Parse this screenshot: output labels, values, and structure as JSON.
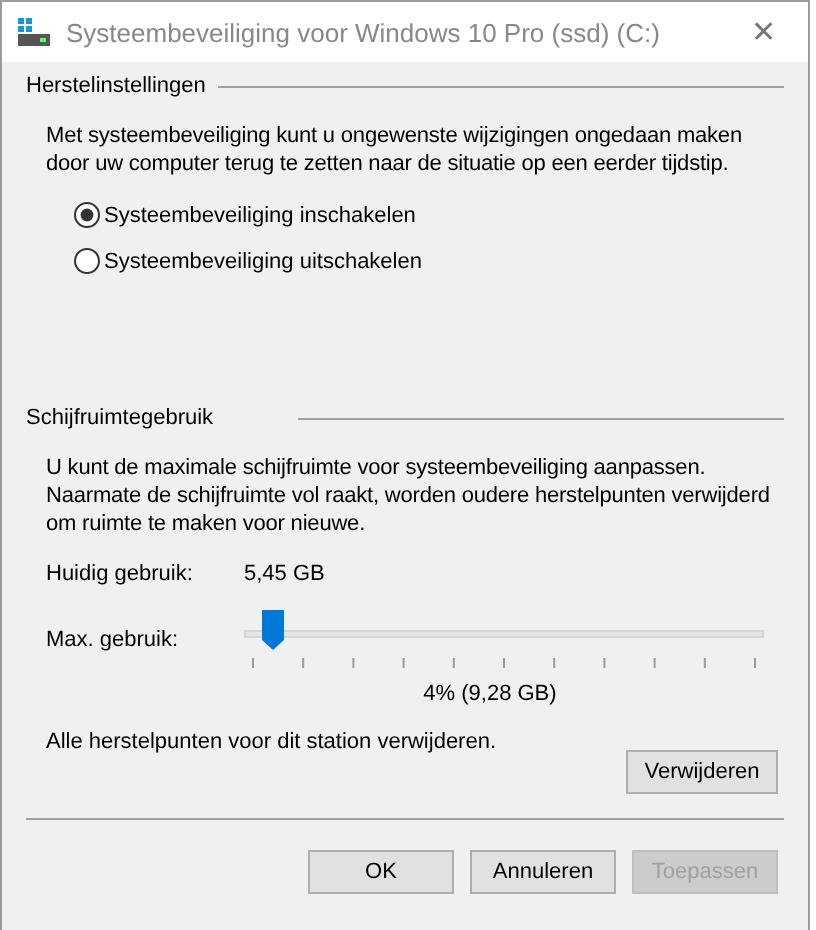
{
  "window": {
    "title": "Systeembeveiliging voor Windows 10 Pro (ssd) (C:)",
    "close": "✕"
  },
  "restore_settings": {
    "heading": "Herstelinstellingen",
    "description": "Met systeembeveiliging kunt u ongewenste wijzigingen ongedaan maken door uw computer terug te zetten naar de situatie op een eerder tijdstip.",
    "options": [
      {
        "label": "Systeembeveiliging inschakelen",
        "selected": true
      },
      {
        "label": "Systeembeveiliging uitschakelen",
        "selected": false
      }
    ]
  },
  "disk_usage": {
    "heading": "Schijfruimtegebruik",
    "description": "U kunt de maximale schijfruimte voor systeembeveiliging aanpassen. Naarmate de schijfruimte vol raakt, worden oudere herstelpunten verwijderd om ruimte te maken voor nieuwe.",
    "current_label": "Huidig gebruik:",
    "current_value": "5,45 GB",
    "max_label": "Max. gebruik:",
    "max_slider": {
      "level": 0.04
    },
    "max_reading": "4% (9,28 GB)",
    "delete_text": "Alle herstelpunten voor dit station verwijderen.",
    "delete_button": "Verwijderen"
  },
  "buttons": [
    {
      "label": "OK",
      "disabled": false
    },
    {
      "label": "Annuleren",
      "disabled": false
    },
    {
      "label": "Toepassen",
      "disabled": true
    }
  ]
}
